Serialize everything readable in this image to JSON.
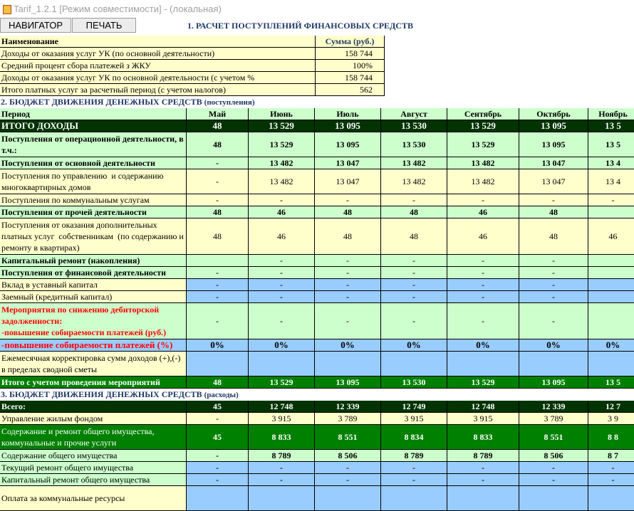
{
  "window": {
    "title": "Tarif_1.2.1  [Режим совместимости] - (локальная)",
    "icon": "excel-app-icon"
  },
  "toolbar": {
    "nav_label": "НАВИГАТОР",
    "print_label": "ПЕЧАТЬ"
  },
  "section1": {
    "title": "1. РАСЧЕТ ПОСТУПЛЕНИЙ ФИНАНСОВЫХ СРЕДСТВ",
    "header": {
      "name": "Наименование",
      "sum": "Сумма (руб.)"
    },
    "rows": [
      {
        "label": "Доходы от оказания услуг УК (по основной деятельности)",
        "value": "158 744"
      },
      {
        "label": "Средний процент сбора платежей з ЖКУ",
        "value": "100%"
      },
      {
        "label": "Доходы от оказания услуг УК по основной деятельности (с учетом  %",
        "value": "158 744"
      },
      {
        "label": "Итого платных услуг за расчетный период (с учетом налогов)",
        "value": "562"
      }
    ]
  },
  "section2": {
    "title": "2. БЮДЖЕТ ДВИЖЕНИЯ ДЕНЕЖНЫХ СРЕДСТВ",
    "subtitle": "(поступления)",
    "period_label": "Период",
    "months": [
      "Май",
      "Июнь",
      "Июль",
      "Август",
      "Сентябрь",
      "Октябрь",
      "Ноябрь"
    ],
    "rows": [
      {
        "label": "ИТОГО ДОХОДЫ",
        "values": [
          "48",
          "13 529",
          "13 095",
          "13 530",
          "13 529",
          "13 095",
          "13 5"
        ]
      },
      {
        "label": "Поступления от операционной деятельности, в т.ч.:",
        "values": [
          "48",
          "13 529",
          "13 095",
          "13 530",
          "13 529",
          "13 095",
          "13 5"
        ]
      },
      {
        "label": "Поступления от основной деятельности",
        "values": [
          "-",
          "13 482",
          "13 047",
          "13 482",
          "13 482",
          "13 047",
          "13 4"
        ]
      },
      {
        "label": "Поступления по управлению  и содержанию многоквартирных домов",
        "values": [
          "-",
          "13 482",
          "13 047",
          "13 482",
          "13 482",
          "13 047",
          "13 4"
        ]
      },
      {
        "label": "Поступления по коммунальным услугам",
        "values": [
          "-",
          "-",
          "-",
          "-",
          "-",
          "-",
          "-"
        ]
      },
      {
        "label": "Поступления от прочей деятельности",
        "values": [
          "48",
          "46",
          "48",
          "48",
          "46",
          "48",
          ""
        ]
      },
      {
        "label": "Поступления от оказания дополнительных платных услуг  собственникам  (по содержанию и ремонту в квартирах)",
        "values": [
          "48",
          "46",
          "48",
          "48",
          "46",
          "48",
          "46"
        ]
      },
      {
        "label": "Капитальный ремонт (накопления)",
        "values": [
          "",
          "-",
          "-",
          "-",
          "-",
          "-",
          ""
        ]
      },
      {
        "label": "Поступления от финансовой деятельности",
        "values": [
          "-",
          "-",
          "-",
          "-",
          "-",
          "-",
          ""
        ]
      },
      {
        "label": "Вклад в уставный капитал",
        "values": [
          "-",
          "-",
          "-",
          "-",
          "-",
          "-",
          ""
        ]
      },
      {
        "label": "Заемный (кредитный капитал)",
        "values": [
          "-",
          "-",
          "-",
          "-",
          "-",
          "-",
          ""
        ]
      },
      {
        "label": "Мероприятия по снижению дебиторской задолженности:\n-повышение собираемости платежей (руб.)",
        "values": [
          "-",
          "-",
          "-",
          "-",
          "-",
          "-",
          ""
        ]
      },
      {
        "label": "-повышение собираемости платежей (%)",
        "values": [
          "0%",
          "0%",
          "0%",
          "0%",
          "0%",
          "0%",
          "0%"
        ]
      },
      {
        "label": "Ежемесячная корректировка сумм доходов (+),(-) в пределах сводной сметы",
        "values": [
          "",
          "",
          "",
          "",
          "",
          "",
          ""
        ]
      },
      {
        "label": "Итого с учетом проведения мероприятий",
        "values": [
          "48",
          "13 529",
          "13 095",
          "13 530",
          "13 529",
          "13 095",
          "13 5"
        ]
      }
    ]
  },
  "section3": {
    "title": "3. БЮДЖЕТ ДВИЖЕНИЯ ДЕНЕЖНЫХ СРЕДСТВ",
    "subtitle": "(расходы)",
    "rows": [
      {
        "label": "Всего:",
        "values": [
          "45",
          "12 748",
          "12 339",
          "12 749",
          "12 748",
          "12 339",
          "12 7"
        ]
      },
      {
        "label": "Управление жилым фондом",
        "values": [
          "-",
          "3 915",
          "3 789",
          "3 915",
          "3 915",
          "3 789",
          "3 9"
        ]
      },
      {
        "label": "Содержание и ремонт общего имущества, коммунальные и прочие услуги",
        "values": [
          "45",
          "8 833",
          "8 551",
          "8 834",
          "8 833",
          "8 551",
          "8 8"
        ]
      },
      {
        "label": "Содержание общего имущества",
        "values": [
          "-",
          "8 789",
          "8 506",
          "8 789",
          "8 789",
          "8 506",
          "8 7"
        ]
      },
      {
        "label": "Текущий ремонт общего имущества",
        "values": [
          "-",
          "-",
          "-",
          "-",
          "-",
          "-",
          "-"
        ]
      },
      {
        "label": "Капитальный ремонт общего имущества",
        "values": [
          "-",
          "-",
          "-",
          "-",
          "-",
          "-",
          "-"
        ]
      },
      {
        "label": "Оплата за коммунальные ресурсы",
        "values": [
          "",
          "",
          "",
          "",
          "",
          "",
          ""
        ]
      }
    ]
  },
  "colors": {
    "cream": "#ffffcc",
    "light_green": "#ccffcc",
    "blue": "#99ccff",
    "dark_green": "#003300",
    "mid_green": "#008000",
    "heading_blue": "#1f3864",
    "red_text": "#ff0000"
  }
}
